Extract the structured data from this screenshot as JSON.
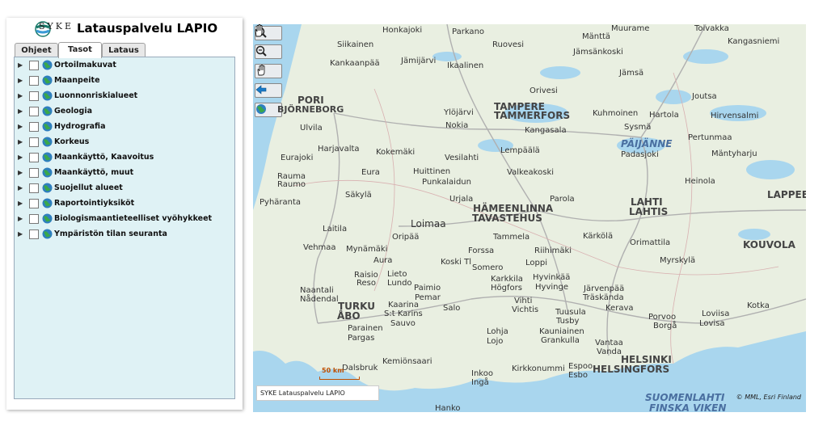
{
  "header": {
    "logo_text": "SYKE",
    "title": "Latauspalvelu LAPIO"
  },
  "tabs": [
    {
      "label": "Ohjeet"
    },
    {
      "label": "Tasot"
    },
    {
      "label": "Lataus"
    }
  ],
  "layers": [
    {
      "label": "Ortoilmakuvat"
    },
    {
      "label": "Maanpeite"
    },
    {
      "label": "Luonnonriskialueet"
    },
    {
      "label": "Geologia"
    },
    {
      "label": "Hydrografia"
    },
    {
      "label": "Korkeus"
    },
    {
      "label": "Maankäyttö, Kaavoitus"
    },
    {
      "label": "Maankäyttö, muut"
    },
    {
      "label": "Suojellut alueet"
    },
    {
      "label": "Raportointiyksiköt"
    },
    {
      "label": "Biologismaantieteelliset vyöhykkeet"
    },
    {
      "label": "Ympäristön tilan seuranta"
    }
  ],
  "map_tools": [
    {
      "icon": "zoom-in-icon"
    },
    {
      "icon": "zoom-out-icon"
    },
    {
      "icon": "pan-hand-icon"
    },
    {
      "icon": "back-arrow-icon"
    },
    {
      "icon": "full-extent-globe-icon"
    }
  ],
  "map": {
    "scale_label": "50 km",
    "credit": "SYKE Latauspalvelu LAPIO",
    "copyright": "© MML, Esri Finland",
    "places": [
      {
        "t": "Honkajoki"
      },
      {
        "t": "Parkano"
      },
      {
        "t": "Mänttä"
      },
      {
        "t": "Muurame"
      },
      {
        "t": "Toivakka"
      },
      {
        "t": "Siikainen"
      },
      {
        "t": "Ruovesi"
      },
      {
        "t": "Jämsänkoski"
      },
      {
        "t": "Kangasniemi"
      },
      {
        "t": "Kankaanpää"
      },
      {
        "t": "Jämijärvi"
      },
      {
        "t": "Ikaalinen"
      },
      {
        "t": "Jämsä"
      },
      {
        "t": "Joutsa"
      },
      {
        "t": "PORI"
      },
      {
        "t": "BJÖRNEBORG"
      },
      {
        "t": "Ylöjärvi"
      },
      {
        "t": "TAMPERE"
      },
      {
        "t": "TAMMERFORS"
      },
      {
        "t": "Orivesi"
      },
      {
        "t": "Kuhmoinen"
      },
      {
        "t": "Hartola"
      },
      {
        "t": "Hirvensalmi"
      },
      {
        "t": "Ulvila"
      },
      {
        "t": "Nokia"
      },
      {
        "t": "Kangasala"
      },
      {
        "t": "Sysmä"
      },
      {
        "t": "PÄIJÄNNE"
      },
      {
        "t": "Harjavalta"
      },
      {
        "t": "Kokemäki"
      },
      {
        "t": "Vesilahti"
      },
      {
        "t": "Lempäälä"
      },
      {
        "t": "Padasjoki"
      },
      {
        "t": "Pertunmaa"
      },
      {
        "t": "Mäntyharju"
      },
      {
        "t": "Eurajoki"
      },
      {
        "t": "Rauma"
      },
      {
        "t": "Raumo"
      },
      {
        "t": "Huittinen"
      },
      {
        "t": "Valkeakoski"
      },
      {
        "t": "Heinola"
      },
      {
        "t": "Eura"
      },
      {
        "t": "Punkalaidun"
      },
      {
        "t": "Säkylä"
      },
      {
        "t": "Urjala"
      },
      {
        "t": "Parola"
      },
      {
        "t": "LAHTI"
      },
      {
        "t": "LAHTIS"
      },
      {
        "t": "LAPPEE"
      },
      {
        "t": "Pyhäranta"
      },
      {
        "t": "HÄMEENLINNA"
      },
      {
        "t": "TAVASTEHUS"
      },
      {
        "t": "Loimaa"
      },
      {
        "t": "Laitila"
      },
      {
        "t": "Oripää"
      },
      {
        "t": "Forssa"
      },
      {
        "t": "Tammela"
      },
      {
        "t": "Kärkölä"
      },
      {
        "t": "Orimattila"
      },
      {
        "t": "KOUVOLA"
      },
      {
        "t": "Vehmaa"
      },
      {
        "t": "Mynämäki"
      },
      {
        "t": "Riihimäki"
      },
      {
        "t": "Aura"
      },
      {
        "t": "Koski Tl"
      },
      {
        "t": "Somero"
      },
      {
        "t": "Loppi"
      },
      {
        "t": "Myrskylä"
      },
      {
        "t": "Raisio"
      },
      {
        "t": "Reso"
      },
      {
        "t": "Lieto"
      },
      {
        "t": "Lundo"
      },
      {
        "t": "Paimio"
      },
      {
        "t": "Pemar"
      },
      {
        "t": "Karkkila"
      },
      {
        "t": "Högfors"
      },
      {
        "t": "Hyvinkää"
      },
      {
        "t": "Hyvinge"
      },
      {
        "t": "Järvenpää"
      },
      {
        "t": "Träskända"
      },
      {
        "t": "Porvoo"
      },
      {
        "t": "Borgå"
      },
      {
        "t": "Kotka"
      },
      {
        "t": "Naantali"
      },
      {
        "t": "Nådendal"
      },
      {
        "t": "TURKU"
      },
      {
        "t": "ÅBO"
      },
      {
        "t": "Kaarina"
      },
      {
        "t": "S:t Karins"
      },
      {
        "t": "Salo"
      },
      {
        "t": "Vihti"
      },
      {
        "t": "Vichtis"
      },
      {
        "t": "Tuusula"
      },
      {
        "t": "Tusby"
      },
      {
        "t": "Kerava"
      },
      {
        "t": "Loviisa"
      },
      {
        "t": "Lovisa"
      },
      {
        "t": "Parainen"
      },
      {
        "t": "Pargas"
      },
      {
        "t": "Sauvo"
      },
      {
        "t": "Lohja"
      },
      {
        "t": "Lojo"
      },
      {
        "t": "Kauniainen"
      },
      {
        "t": "Grankulla"
      },
      {
        "t": "Vantaa"
      },
      {
        "t": "Vanda"
      },
      {
        "t": "HELSINKI"
      },
      {
        "t": "HELSINGFORS"
      },
      {
        "t": "Espoo"
      },
      {
        "t": "Esbo"
      },
      {
        "t": "Kirkkonummi"
      },
      {
        "t": "Inkoo"
      },
      {
        "t": "Ingå"
      },
      {
        "t": "Kemiönsaari"
      },
      {
        "t": "Dalsbruk"
      },
      {
        "t": "Hanko"
      },
      {
        "t": "SUOMENLAHTI"
      },
      {
        "t": "FINSKA VIKEN"
      }
    ]
  }
}
